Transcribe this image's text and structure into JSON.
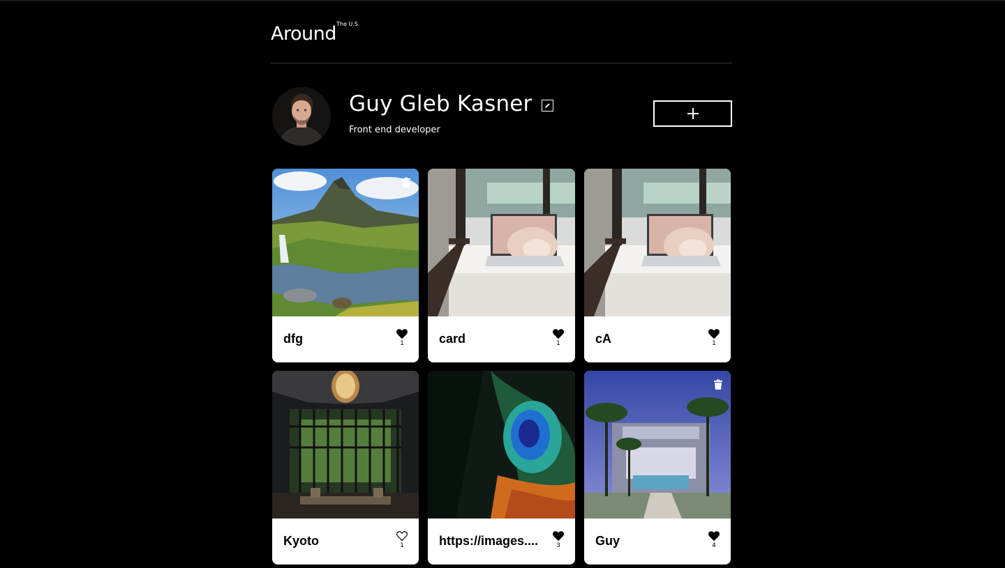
{
  "header": {
    "logo": "Around",
    "logo_sub": "The U.S."
  },
  "profile": {
    "name": "Guy Gleb Kasner",
    "job": "Front end developer",
    "edit_icon": "pencil-icon",
    "add_icon": "plus-icon"
  },
  "cards": [
    {
      "title": "dfg",
      "likes": "1",
      "liked": true,
      "deletable": true,
      "image": "mountain-waterfall"
    },
    {
      "title": "card",
      "likes": "1",
      "liked": true,
      "deletable": false,
      "image": "laptop-on-sofa"
    },
    {
      "title": "cA",
      "likes": "1",
      "liked": true,
      "deletable": false,
      "image": "laptop-on-sofa"
    },
    {
      "title": "Kyoto",
      "likes": "1",
      "liked": false,
      "deletable": false,
      "image": "kyoto-interior"
    },
    {
      "title": "https://images....",
      "likes": "3",
      "liked": true,
      "deletable": false,
      "image": "peacock-feather"
    },
    {
      "title": "Guy",
      "likes": "4",
      "liked": true,
      "deletable": true,
      "image": "building-with-palms"
    }
  ]
}
